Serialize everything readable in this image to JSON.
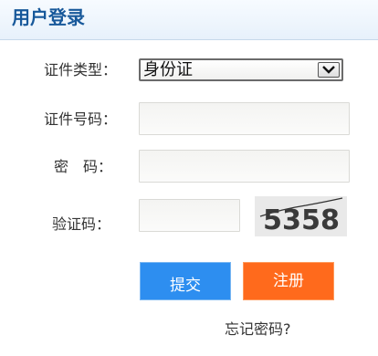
{
  "header": {
    "title": "用户登录"
  },
  "form": {
    "id_type": {
      "label": "证件类型：",
      "selected": "身份证"
    },
    "id_number": {
      "label": "证件号码：",
      "value": ""
    },
    "password": {
      "label": "密　码：",
      "value": ""
    },
    "captcha": {
      "label": "验证码：",
      "value": "",
      "image_text": "5358"
    }
  },
  "buttons": {
    "submit": "提交",
    "register": "注册"
  },
  "links": {
    "forgot_password": "忘记密码?"
  },
  "colors": {
    "header_title": "#17589a",
    "submit_bg": "#2d8ef0",
    "register_bg": "#ff6a1c"
  }
}
